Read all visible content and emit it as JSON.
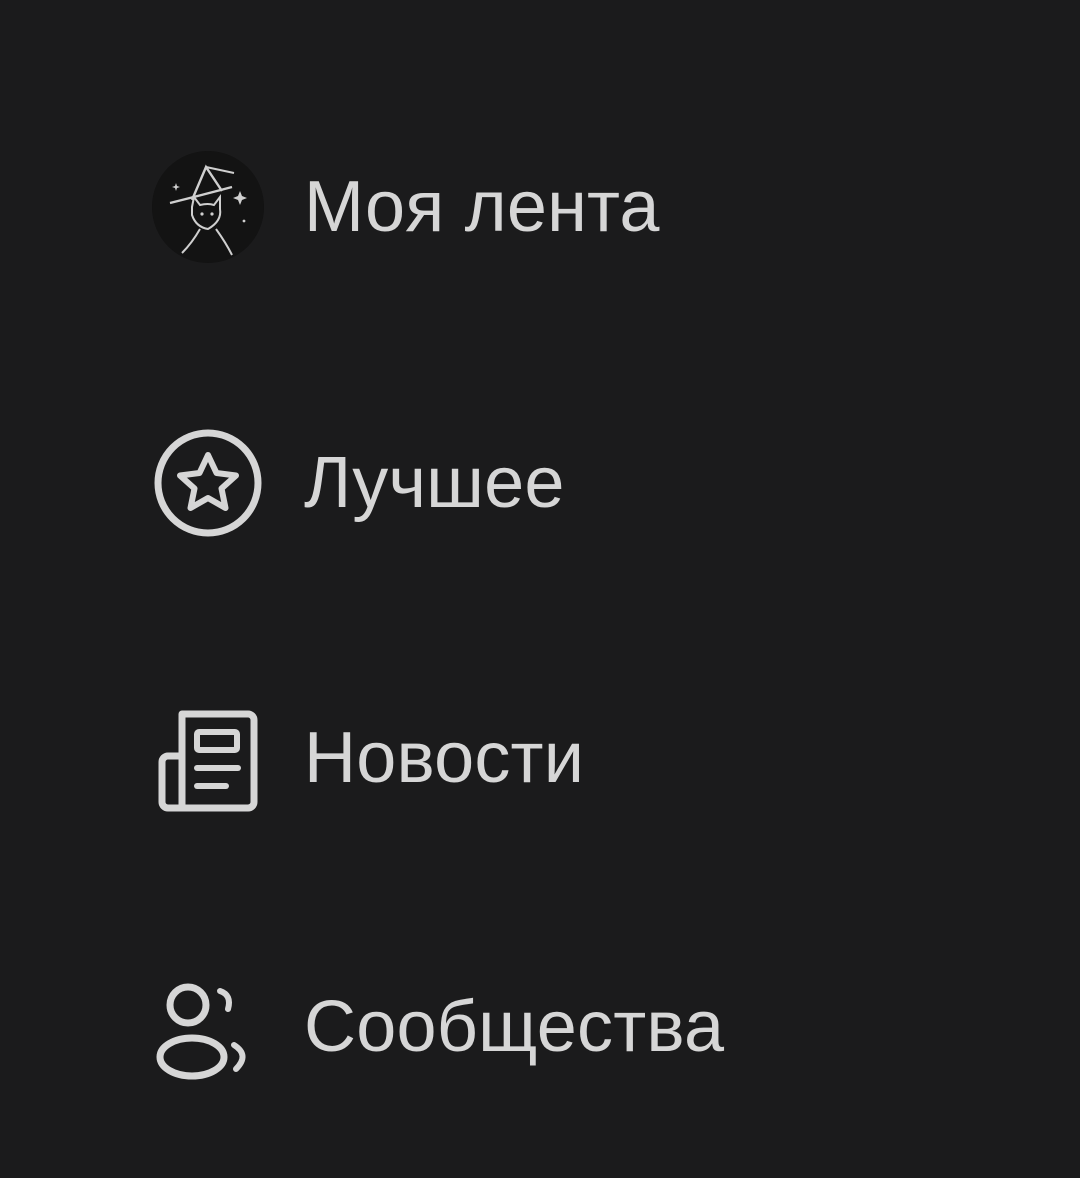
{
  "menu": {
    "items": [
      {
        "label": "Моя лента",
        "icon": "avatar-witch-cat"
      },
      {
        "label": "Лучшее",
        "icon": "star-circle-icon"
      },
      {
        "label": "Новости",
        "icon": "newspaper-icon"
      },
      {
        "label": "Сообщества",
        "icon": "users-icon"
      }
    ]
  },
  "colors": {
    "background": "#1b1b1c",
    "text": "#d6d6d6",
    "icon": "#d6d6d6"
  }
}
